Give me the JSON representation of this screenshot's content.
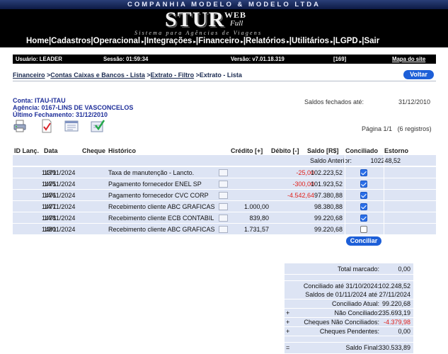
{
  "header": {
    "company": "COMPANHIA MODELO & MODELO LTDA",
    "logo_main": "STUR",
    "logo_web": "WEB",
    "logo_full": "Full",
    "slogan": "Sistema para Agências de Viagens"
  },
  "menu": {
    "items": [
      "Home",
      "Cadastros",
      "Operacional",
      "Integrações",
      "Financeiro",
      "Relatórios",
      "Utilitários",
      "LGPD",
      "Sair"
    ]
  },
  "status": {
    "user": "Usuário: LEADER",
    "session": "Sessão: 01:59:34",
    "version": "Versão: v7.01.18.319",
    "count": "[169]",
    "sitemap": "Mapa do site"
  },
  "breadcrumb": {
    "items": [
      "Financeiro",
      "Contas Caixas e Bancos - Lista",
      "Extrato - Filtro",
      "Extrato - Lista"
    ],
    "sep": " >"
  },
  "buttons": {
    "voltar": "Voltar",
    "conciliar": "Conciliar"
  },
  "account": {
    "conta": "Conta: ITAU-ITAU",
    "agencia": "Agência: 0167-LINS DE VASCONCELOS",
    "fechamento": "Último Fechamento: 31/12/2010",
    "saldos_label": "Saldos fechados até:",
    "saldos_date": "31/12/2010"
  },
  "icons": [
    "printer-icon",
    "checklist-icon",
    "report-icon",
    "approve-icon"
  ],
  "pagination": {
    "page": "Página 1/1",
    "registros": "(6 registros)"
  },
  "table": {
    "headers": {
      "id": "ID Lanç.",
      "data": "Data",
      "cheque": "Cheque",
      "historico": "Histórico",
      "credito": "Crédito [+]",
      "debito": "Débito [-]",
      "saldo": "Saldo [R$]",
      "conciliado": "Conciliado",
      "estorno": "Estorno"
    },
    "saldo_anterior_label": "Saldo Anterior:",
    "saldo_anterior_value": "102248,52",
    "rows": [
      {
        "id": "1479",
        "data": "13/11/2024",
        "hist": "Taxa de manutenção - Lancto.",
        "credito": "",
        "debito": "-25,00",
        "saldo": "102.223,52",
        "conciliado": true
      },
      {
        "id": "1475",
        "data": "14/11/2024",
        "hist": "Pagamento fornecedor ENEL SP",
        "credito": "",
        "debito": "-300,00",
        "saldo": "101.923,52",
        "conciliado": true
      },
      {
        "id": "1476",
        "data": "14/11/2024",
        "hist": "Pagamento fornecedor CVC CORP",
        "credito": "",
        "debito": "-4.542,64",
        "saldo": "97.380,88",
        "conciliado": true
      },
      {
        "id": "1477",
        "data": "14/11/2024",
        "hist": "Recebimento cliente ABC GRAFICAS",
        "credito": "1.000,00",
        "debito": "",
        "saldo": "98.380,88",
        "conciliado": true
      },
      {
        "id": "1478",
        "data": "14/11/2024",
        "hist": "Recebimento cliente ECB CONTABIL",
        "credito": "839,80",
        "debito": "",
        "saldo": "99.220,68",
        "conciliado": true
      },
      {
        "id": "1480",
        "data": "19/11/2024",
        "hist": "Recebimento cliente ABC GRAFICAS",
        "credito": "1.731,57",
        "debito": "",
        "saldo": "99.220,68",
        "conciliado": false
      }
    ]
  },
  "summary": {
    "total_marcado_label": "Total marcado:",
    "total_marcado": "0,00",
    "conciliado_ate_label": "Conciliado até 31/10/2024:",
    "conciliado_ate": "102.248,52",
    "saldos_periodo": "Saldos de 01/11/2024 até 27/11/2024",
    "conciliado_atual_label": "Conciliado Atual:",
    "conciliado_atual": "99.220,68",
    "nao_conciliado_label": "Não Conciliado:",
    "nao_conciliado": "235.693,19",
    "cheques_nao_label": "Cheques Não Conciliados:",
    "cheques_nao": "-4.379,98",
    "cheques_pend_label": "Cheques Pendentes:",
    "cheques_pend": "0,00",
    "saldo_final_label": "Saldo Final:",
    "saldo_final": "330.533,89",
    "plus": "+",
    "equals": "="
  }
}
